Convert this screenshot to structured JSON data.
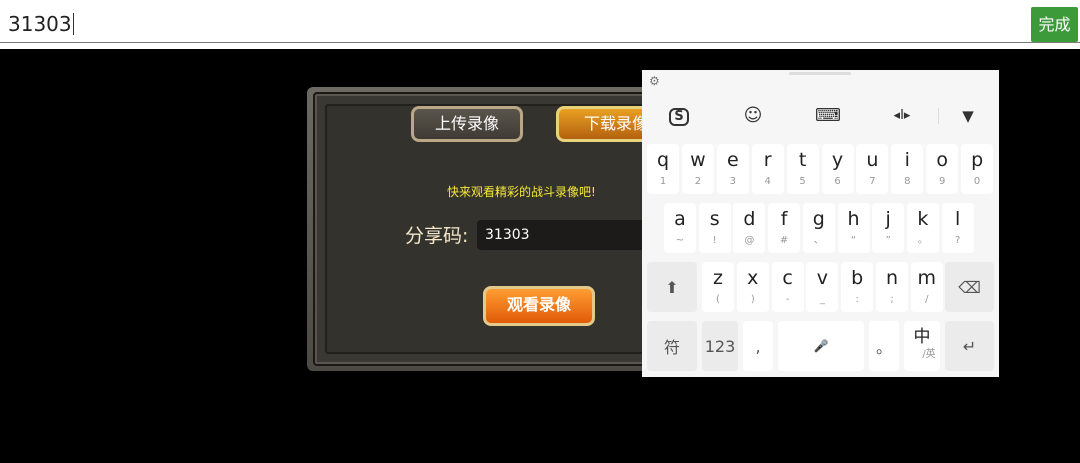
{
  "input": {
    "value": "31303",
    "done_label": "完成"
  },
  "game": {
    "upload_label": "上传录像",
    "download_label": "下载录像",
    "tagline": "快来观看精彩的战斗录像吧!",
    "share_label": "分享码:",
    "share_code": "31303",
    "watch_label": "观看录像"
  },
  "keyboard": {
    "toolbar": [
      {
        "name": "sogou-logo-icon",
        "glyph": "S"
      },
      {
        "name": "emoji-icon",
        "glyph": "☺"
      },
      {
        "name": "keyboard-icon",
        "glyph": "⌨"
      },
      {
        "name": "cursor-move-icon",
        "glyph": "◂I▸"
      },
      {
        "name": "collapse-keyboard-icon",
        "glyph": "▼"
      }
    ],
    "row1": [
      {
        "main": "q",
        "sub": "1"
      },
      {
        "main": "w",
        "sub": "2"
      },
      {
        "main": "e",
        "sub": "3"
      },
      {
        "main": "r",
        "sub": "4"
      },
      {
        "main": "t",
        "sub": "5"
      },
      {
        "main": "y",
        "sub": "6"
      },
      {
        "main": "u",
        "sub": "7"
      },
      {
        "main": "i",
        "sub": "8"
      },
      {
        "main": "o",
        "sub": "9"
      },
      {
        "main": "p",
        "sub": "0"
      }
    ],
    "row2": [
      {
        "main": "a",
        "sub": "~"
      },
      {
        "main": "s",
        "sub": "!"
      },
      {
        "main": "d",
        "sub": "@"
      },
      {
        "main": "f",
        "sub": "#"
      },
      {
        "main": "g",
        "sub": "、"
      },
      {
        "main": "h",
        "sub": "“"
      },
      {
        "main": "j",
        "sub": "”"
      },
      {
        "main": "k",
        "sub": "。"
      },
      {
        "main": "l",
        "sub": "?"
      }
    ],
    "row3": [
      {
        "main": "z",
        "sub": "("
      },
      {
        "main": "x",
        "sub": ")"
      },
      {
        "main": "c",
        "sub": "-"
      },
      {
        "main": "v",
        "sub": "_"
      },
      {
        "main": "b",
        "sub": ":"
      },
      {
        "main": "n",
        "sub": ";"
      },
      {
        "main": "m",
        "sub": "/"
      }
    ],
    "shift_glyph": "⬆",
    "backspace_glyph": "⌫",
    "symbols_label": "符",
    "numbers_label": "123",
    "comma_label": ",",
    "mic_glyph": "🎤",
    "period_label": "。",
    "lang_main": "中",
    "lang_sub": "/英",
    "enter_glyph": "↵"
  }
}
